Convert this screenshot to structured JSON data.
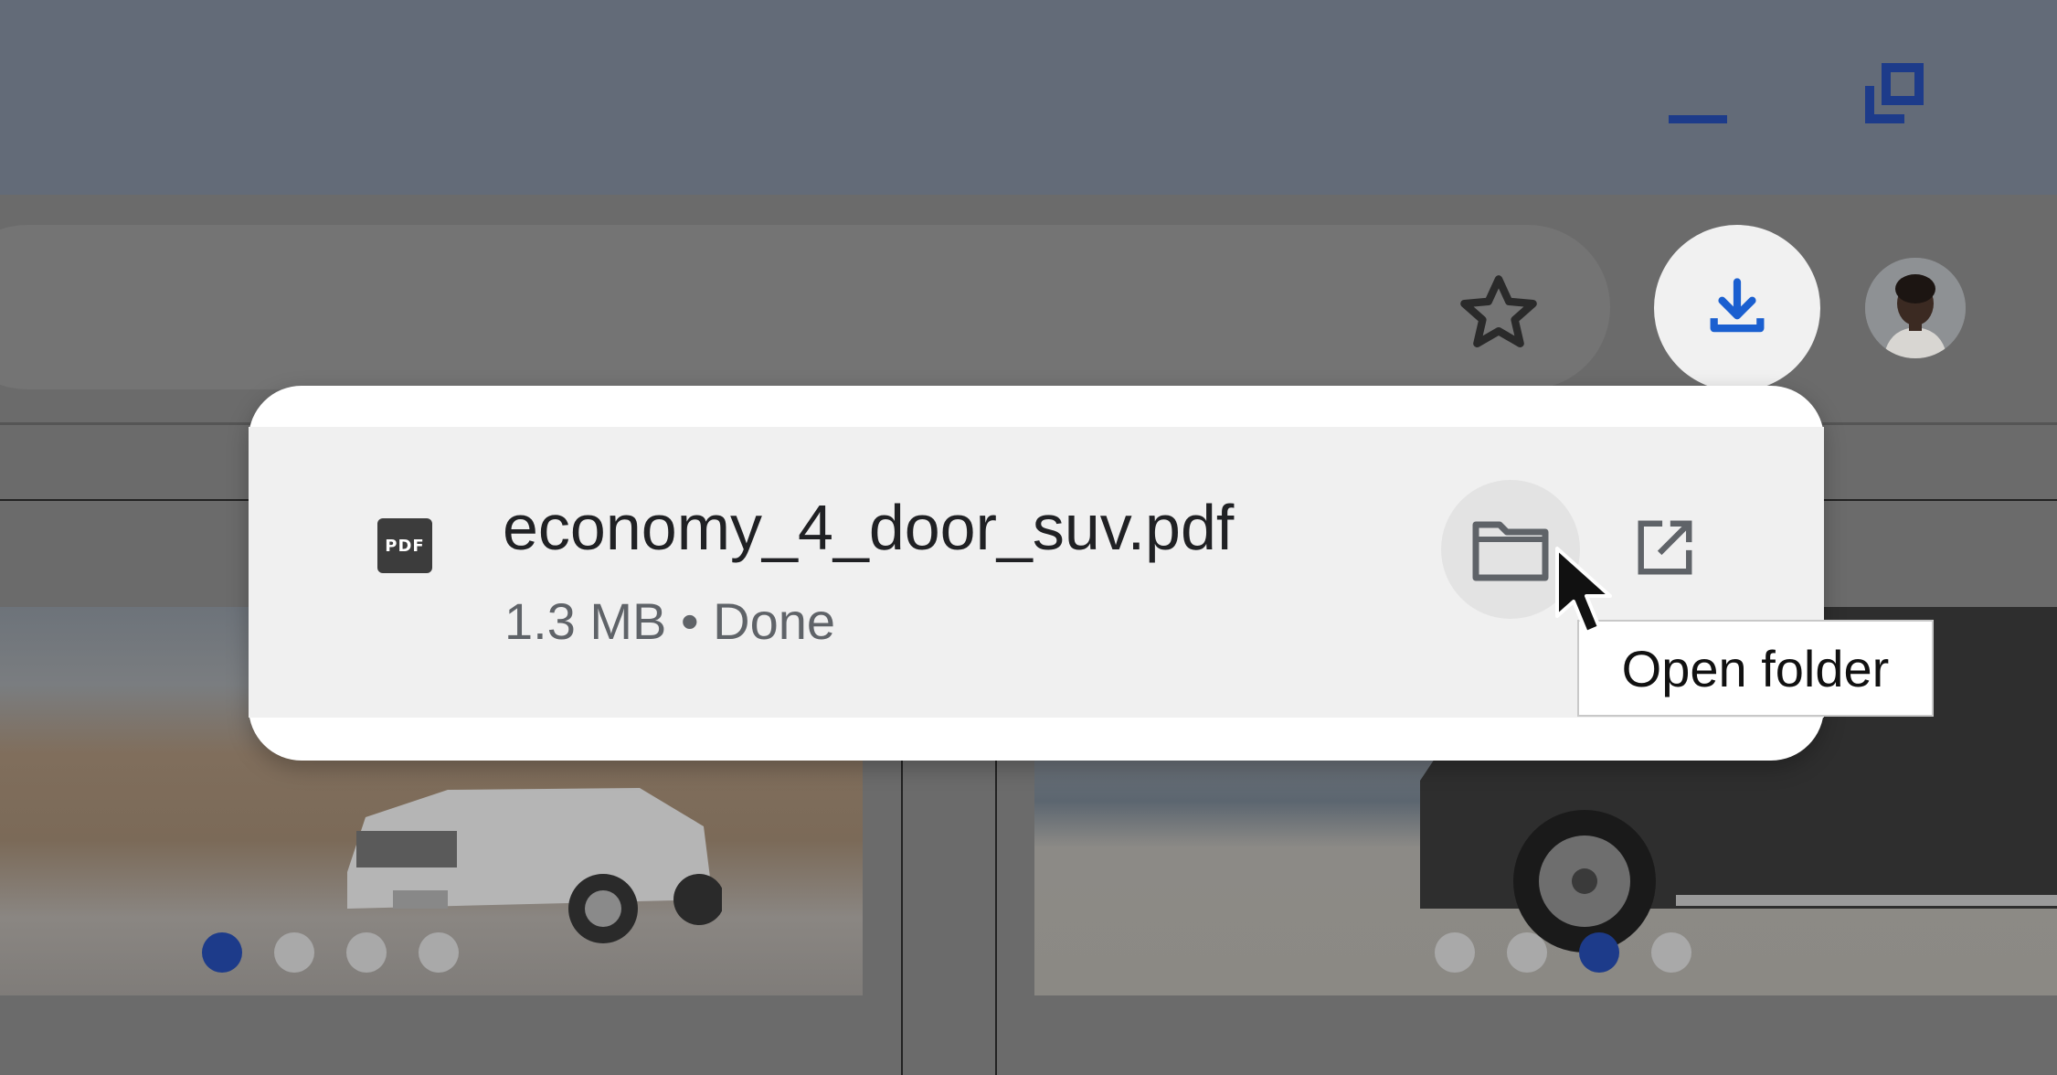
{
  "window": {
    "minimize_icon": "minimize-icon",
    "restore_icon": "restore-icon"
  },
  "toolbar": {
    "bookmark_icon": "star-outline-icon",
    "download_icon": "download-icon",
    "profile_icon": "avatar"
  },
  "downloads_popup": {
    "items": [
      {
        "file_type_icon": "pdf-file-icon",
        "file_type_label": "PDF",
        "filename": "economy_4_door_suv.pdf",
        "status": "1.3 MB • Done",
        "actions": [
          {
            "icon": "folder-icon",
            "label": "Open folder",
            "hovered": true
          },
          {
            "icon": "open-external-icon"
          }
        ]
      }
    ],
    "tooltip": "Open folder"
  },
  "page": {
    "carousels": [
      {
        "dots": 4,
        "active_index": 0
      },
      {
        "dots": 4,
        "active_index": 2
      }
    ]
  },
  "colors": {
    "accent_blue": "#1d3b8a",
    "download_blue": "#1a5fd0",
    "popup_bg": "#ffffff",
    "item_bg": "#f0f0f0",
    "scrim": "#6b6b6b"
  }
}
